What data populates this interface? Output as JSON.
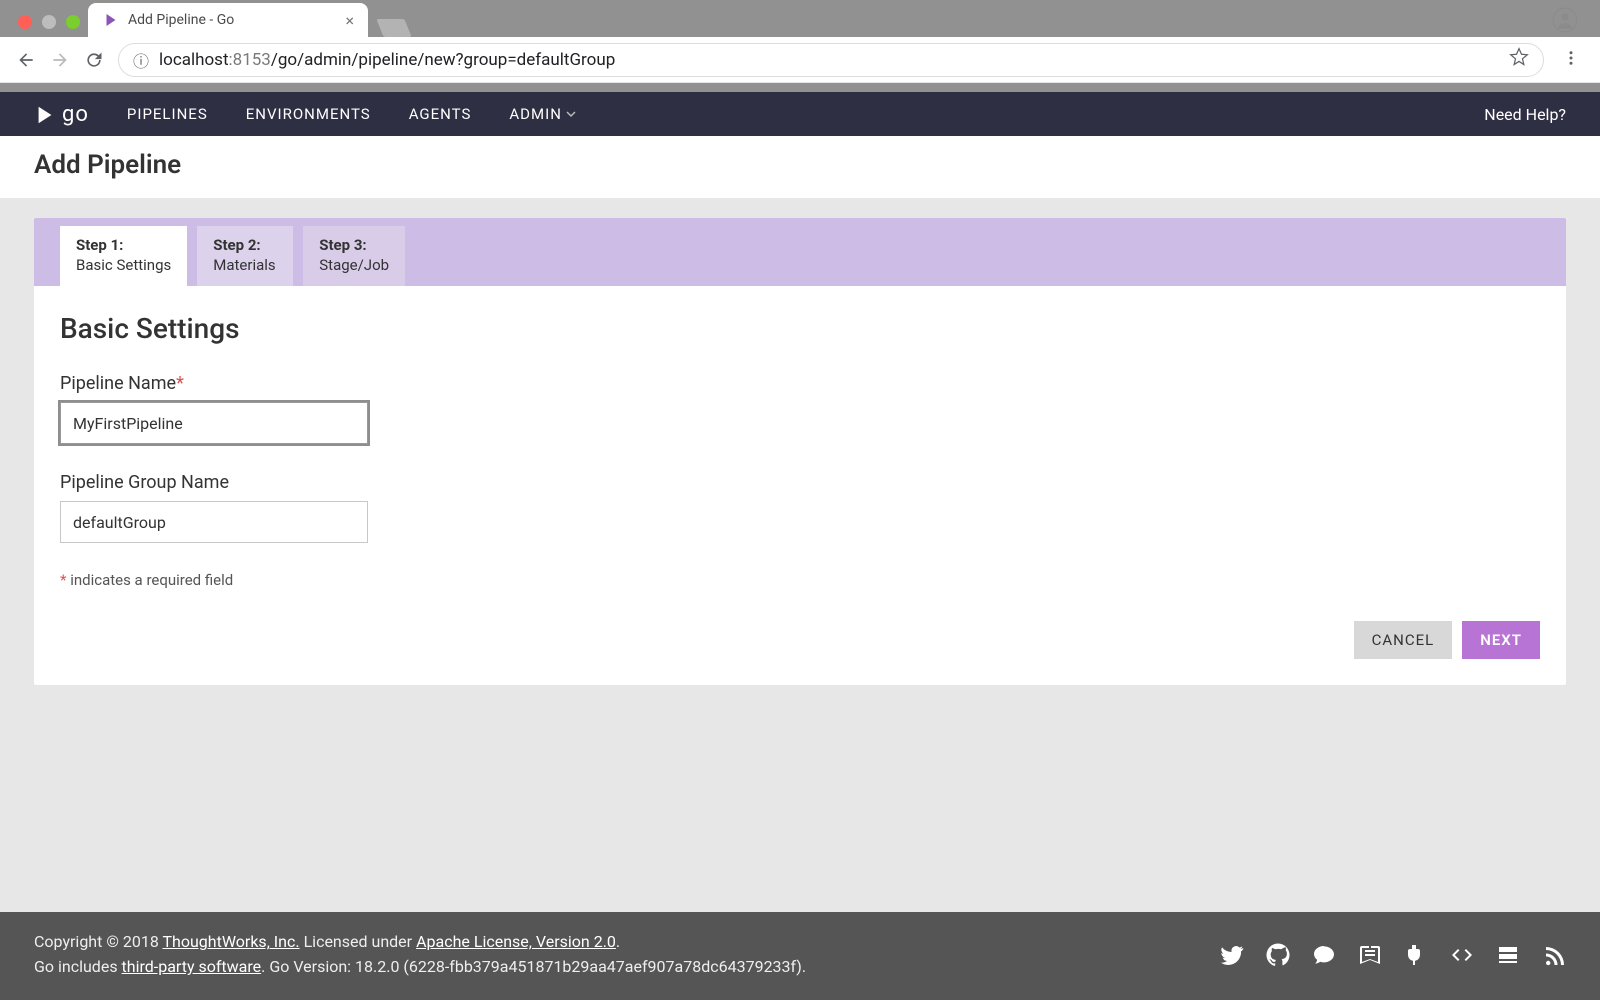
{
  "browser": {
    "tab_title": "Add Pipeline - Go",
    "url_host": "localhost",
    "url_port": ":8153",
    "url_path": "/go/admin/pipeline/new?group=defaultGroup"
  },
  "nav": {
    "logo_text": "go",
    "items": [
      "PIPELINES",
      "ENVIRONMENTS",
      "AGENTS",
      "ADMIN"
    ],
    "help": "Need Help?"
  },
  "page_title": "Add Pipeline",
  "wizard": {
    "tabs": [
      {
        "step": "Step 1:",
        "label": "Basic Settings"
      },
      {
        "step": "Step 2:",
        "label": "Materials"
      },
      {
        "step": "Step 3:",
        "label": "Stage/Job"
      }
    ],
    "heading": "Basic Settings",
    "fields": {
      "pipeline_name_label": "Pipeline Name",
      "pipeline_name_value": "MyFirstPipeline",
      "group_name_label": "Pipeline Group Name",
      "group_name_value": "defaultGroup"
    },
    "required_note": " indicates a required field",
    "required_star": "*",
    "cancel": "CANCEL",
    "next": "NEXT"
  },
  "footer": {
    "line1_pre": "Copyright © 2018 ",
    "line1_link": "ThoughtWorks, Inc.",
    "line1_mid": " Licensed under ",
    "line1_link2": "Apache License, Version 2.0",
    "line1_post": ".",
    "line2_pre": "Go includes ",
    "line2_link": "third-party software",
    "line2_post": ". Go Version: 18.2.0 (6228-fbb379a451871b29aa47aef907a78dc64379233f)."
  }
}
